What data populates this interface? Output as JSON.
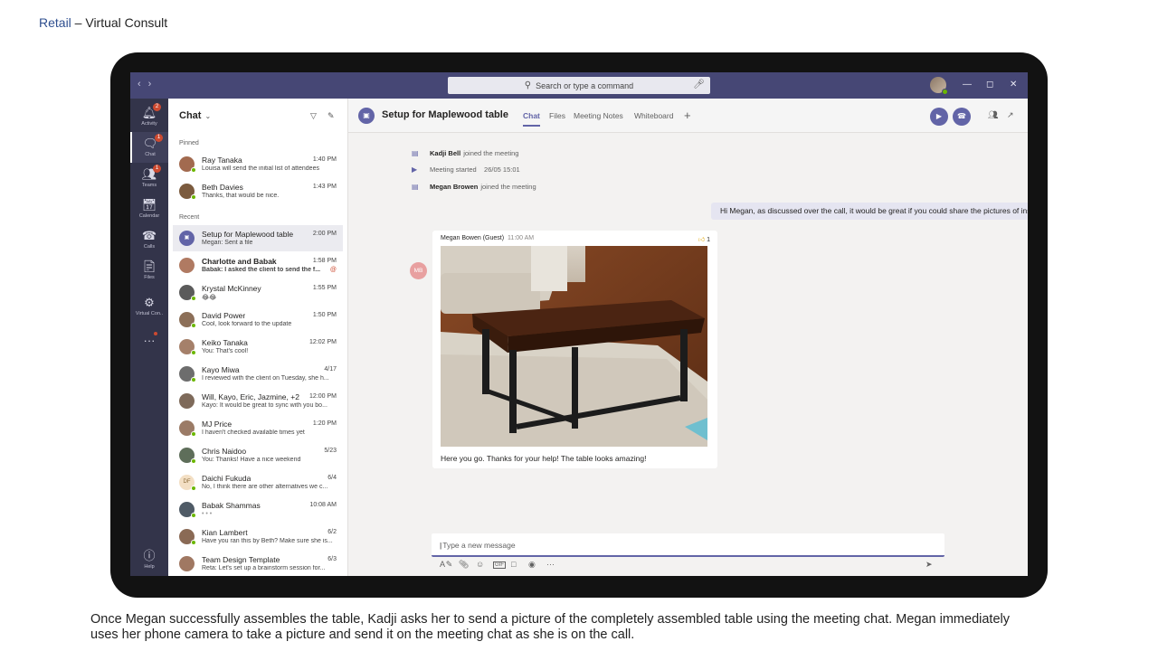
{
  "slide": {
    "title_accent": "Retail",
    "title_rest": " – Virtual Consult",
    "caption": "Once Megan successfully assembles the table, Kadji asks her to send a picture of the completely assembled table using the meeting chat. Megan immediately uses her phone camera to take a picture and send it on the meeting chat as she is on the call."
  },
  "titlebar": {
    "search_placeholder": "Search or type a command"
  },
  "rail": {
    "items": [
      {
        "label": "Activity",
        "icon": "bell-icon",
        "badge": "2"
      },
      {
        "label": "Chat",
        "icon": "chat-icon",
        "badge": "1"
      },
      {
        "label": "Teams",
        "icon": "teams-icon",
        "badge": "1"
      },
      {
        "label": "Calendar",
        "icon": "calendar-icon",
        "badge": ""
      },
      {
        "label": "Calls",
        "icon": "phone-icon",
        "badge": ""
      },
      {
        "label": "Files",
        "icon": "file-icon",
        "badge": ""
      },
      {
        "label": "Virtual Con..",
        "icon": "virtual-consult-icon",
        "badge": ""
      }
    ],
    "help_label": "Help"
  },
  "chatlist": {
    "title": "Chat",
    "pinned_label": "Pinned",
    "recent_label": "Recent",
    "pinned": [
      {
        "name": "Ray Tanaka",
        "time": "1:40 PM",
        "preview": "Louisa will send the initial list of attendees"
      },
      {
        "name": "Beth Davies",
        "time": "1:43 PM",
        "preview": "Thanks, that would be nice."
      }
    ],
    "recent": [
      {
        "name": "Setup for Maplewood table",
        "time": "2:00 PM",
        "preview": "Megan: Sent a file"
      },
      {
        "name": "Charlotte and Babak",
        "time": "1:58 PM",
        "preview": "Babak: I asked the client to send the f..."
      },
      {
        "name": "Krystal McKinney",
        "time": "1:55 PM",
        "preview": "😂😂"
      },
      {
        "name": "David Power",
        "time": "1:50 PM",
        "preview": "Cool, look forward to the update"
      },
      {
        "name": "Keiko Tanaka",
        "time": "12:02 PM",
        "preview": "You: That's cool!"
      },
      {
        "name": "Kayo Miwa",
        "time": "4/17",
        "preview": "I reviewed with the client on Tuesday, she h..."
      },
      {
        "name": "Will, Kayo, Eric, Jazmine, +2",
        "time": "12:00 PM",
        "preview": "Kayo: It would be great to sync with you bo..."
      },
      {
        "name": "MJ Price",
        "time": "1:20 PM",
        "preview": "I haven't checked available times yet"
      },
      {
        "name": "Chris Naidoo",
        "time": "5/23",
        "preview": "You: Thanks! Have a nice weekend"
      },
      {
        "name": "Daichi Fukuda",
        "time": "6/4",
        "preview": "No, I think there are other alternatives we c..."
      },
      {
        "name": "Babak Shammas",
        "time": "10:08 AM",
        "preview": "• • •"
      },
      {
        "name": "Kian Lambert",
        "time": "6/2",
        "preview": "Have you ran this by Beth? Make sure she is..."
      },
      {
        "name": "Team Design Template",
        "time": "6/3",
        "preview": "Reta: Let's set up a brainstorm session for..."
      }
    ]
  },
  "main": {
    "title": "Setup for Maplewood table",
    "tabs": [
      "Chat",
      "Files",
      "Meeting Notes",
      "Whiteboard"
    ],
    "system": [
      {
        "who": "Kadji Bell",
        "text": "joined the meeting"
      },
      {
        "who": "",
        "text": "Meeting started",
        "extra": "26/05 15:01"
      },
      {
        "who": "Megan Browen",
        "text": "joined the meeting"
      }
    ],
    "my_message": "Hi Megan, as discussed over the call, it would be great if you could share the pictures of installed table.",
    "guest": {
      "initials": "MB",
      "name": "Megan Bowen (Guest)",
      "time": "11:00 AM",
      "reaction_count": "1",
      "text": "Here you go. Thanks for your help! The table looks amazing!"
    },
    "composer_placeholder": "Type a new message"
  },
  "colors": {
    "brand": "#6264a7",
    "titlebar": "#464775",
    "rail": "#33344a",
    "presence": "#6bb700",
    "badge": "#cc4a31"
  }
}
